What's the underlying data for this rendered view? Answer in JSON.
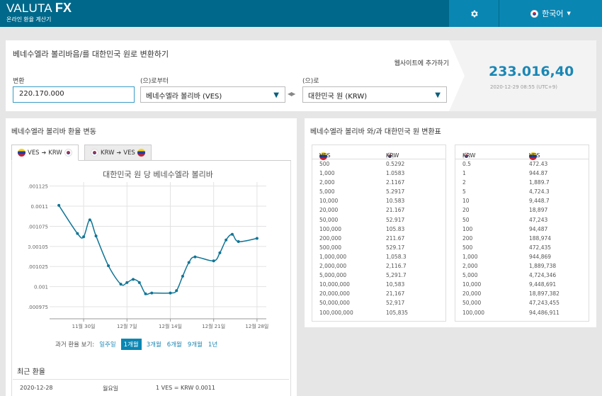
{
  "header": {
    "logo_main": "VALUTA",
    "logo_fx": "FX",
    "logo_sub": "온라인 환율 계산기",
    "language": "한국어",
    "settings_icon": "gear-icon",
    "colors": {
      "bar": "#00688a",
      "accent": "#0a86b3"
    }
  },
  "converter": {
    "title": "베네수엘라 볼리바음/를 대한민국 원로 변환하기",
    "add_to_site": "웹사이트에 추가하기",
    "amount_label": "변환",
    "amount_value": "220.170.000",
    "from_label": "(으)로부터",
    "from_value": "베네수엘라 볼리바 (VES)",
    "to_label": "(으)로",
    "to_value": "대한민국 원 (KRW)",
    "result": "233.016,40",
    "result_time": "2020-12-29 08:55 (UTC+9)"
  },
  "history": {
    "title": "베네수엘라 볼리바 환율 변동",
    "tab_active_from": "VES",
    "tab_active_to": "KRW",
    "tab_inactive_from": "KRW",
    "tab_inactive_to": "VES",
    "period_label": "과거 환율 보기:",
    "periods": [
      "일주일",
      "1개월",
      "3개월",
      "6개월",
      "9개월",
      "1년"
    ],
    "active_period": "1개월",
    "recent_title": "최근 환율",
    "recent_row": {
      "date": "2020-12-28",
      "day": "월요일",
      "rate": "1 VES = KRW 0.0011"
    }
  },
  "chart_data": {
    "type": "line",
    "title": "대한민국 원 당 베네수엘라 볼리바",
    "ylim": [
      0.00096,
      0.00113
    ],
    "yticks": [
      0.000975,
      0.001,
      0.001025,
      0.00105,
      0.001075,
      0.0011,
      0.001125
    ],
    "ytick_labels": [
      "0.000975",
      "0.001",
      "0.001025",
      "0.00105",
      "0.001075",
      "0.0011",
      "0.001125"
    ],
    "xticks": [
      4,
      11,
      18,
      25,
      32
    ],
    "xtick_labels": [
      "11월 30일",
      "12월 7일",
      "12월 14일",
      "12월 21일",
      "12월 28일"
    ],
    "xlim": [
      -1.5,
      33.5
    ],
    "grid": true,
    "color": "#0f7596",
    "x": [
      0,
      3,
      4,
      5,
      6,
      8,
      10,
      11,
      12,
      13,
      14,
      15,
      18,
      19,
      20,
      21,
      22,
      25,
      26,
      27,
      28,
      29,
      32
    ],
    "y": [
      0.001101,
      0.001066,
      0.001062,
      0.001083,
      0.001063,
      0.001026,
      0.001003,
      0.001005,
      0.001009,
      0.001005,
      0.000991,
      0.000992,
      0.000992,
      0.000995,
      0.001013,
      0.00103,
      0.001037,
      0.001032,
      0.001042,
      0.001058,
      0.001065,
      0.001056,
      0.00106
    ]
  },
  "conversion": {
    "title": "베네수엘라 볼리바 와/과 대한민국 원 변환표",
    "left_head": [
      "VES",
      "KRW"
    ],
    "right_head": [
      "KRW",
      "VES"
    ],
    "left_rows": [
      [
        "500",
        "0.5292"
      ],
      [
        "1,000",
        "1.0583"
      ],
      [
        "2,000",
        "2.1167"
      ],
      [
        "5,000",
        "5.2917"
      ],
      [
        "10,000",
        "10.583"
      ],
      [
        "20,000",
        "21.167"
      ],
      [
        "50,000",
        "52.917"
      ],
      [
        "100,000",
        "105.83"
      ],
      [
        "200,000",
        "211.67"
      ],
      [
        "500,000",
        "529.17"
      ],
      [
        "1,000,000",
        "1,058.3"
      ],
      [
        "2,000,000",
        "2,116.7"
      ],
      [
        "5,000,000",
        "5,291.7"
      ],
      [
        "10,000,000",
        "10,583"
      ],
      [
        "20,000,000",
        "21,167"
      ],
      [
        "50,000,000",
        "52,917"
      ],
      [
        "100,000,000",
        "105,835"
      ]
    ],
    "right_rows": [
      [
        "0.5",
        "472.43"
      ],
      [
        "1",
        "944.87"
      ],
      [
        "2",
        "1,889.7"
      ],
      [
        "5",
        "4,724.3"
      ],
      [
        "10",
        "9,448.7"
      ],
      [
        "20",
        "18,897"
      ],
      [
        "50",
        "47,243"
      ],
      [
        "100",
        "94,487"
      ],
      [
        "200",
        "188,974"
      ],
      [
        "500",
        "472,435"
      ],
      [
        "1,000",
        "944,869"
      ],
      [
        "2,000",
        "1,889,738"
      ],
      [
        "5,000",
        "4,724,346"
      ],
      [
        "10,000",
        "9,448,691"
      ],
      [
        "20,000",
        "18,897,382"
      ],
      [
        "50,000",
        "47,243,455"
      ],
      [
        "100,000",
        "94,486,911"
      ]
    ]
  }
}
